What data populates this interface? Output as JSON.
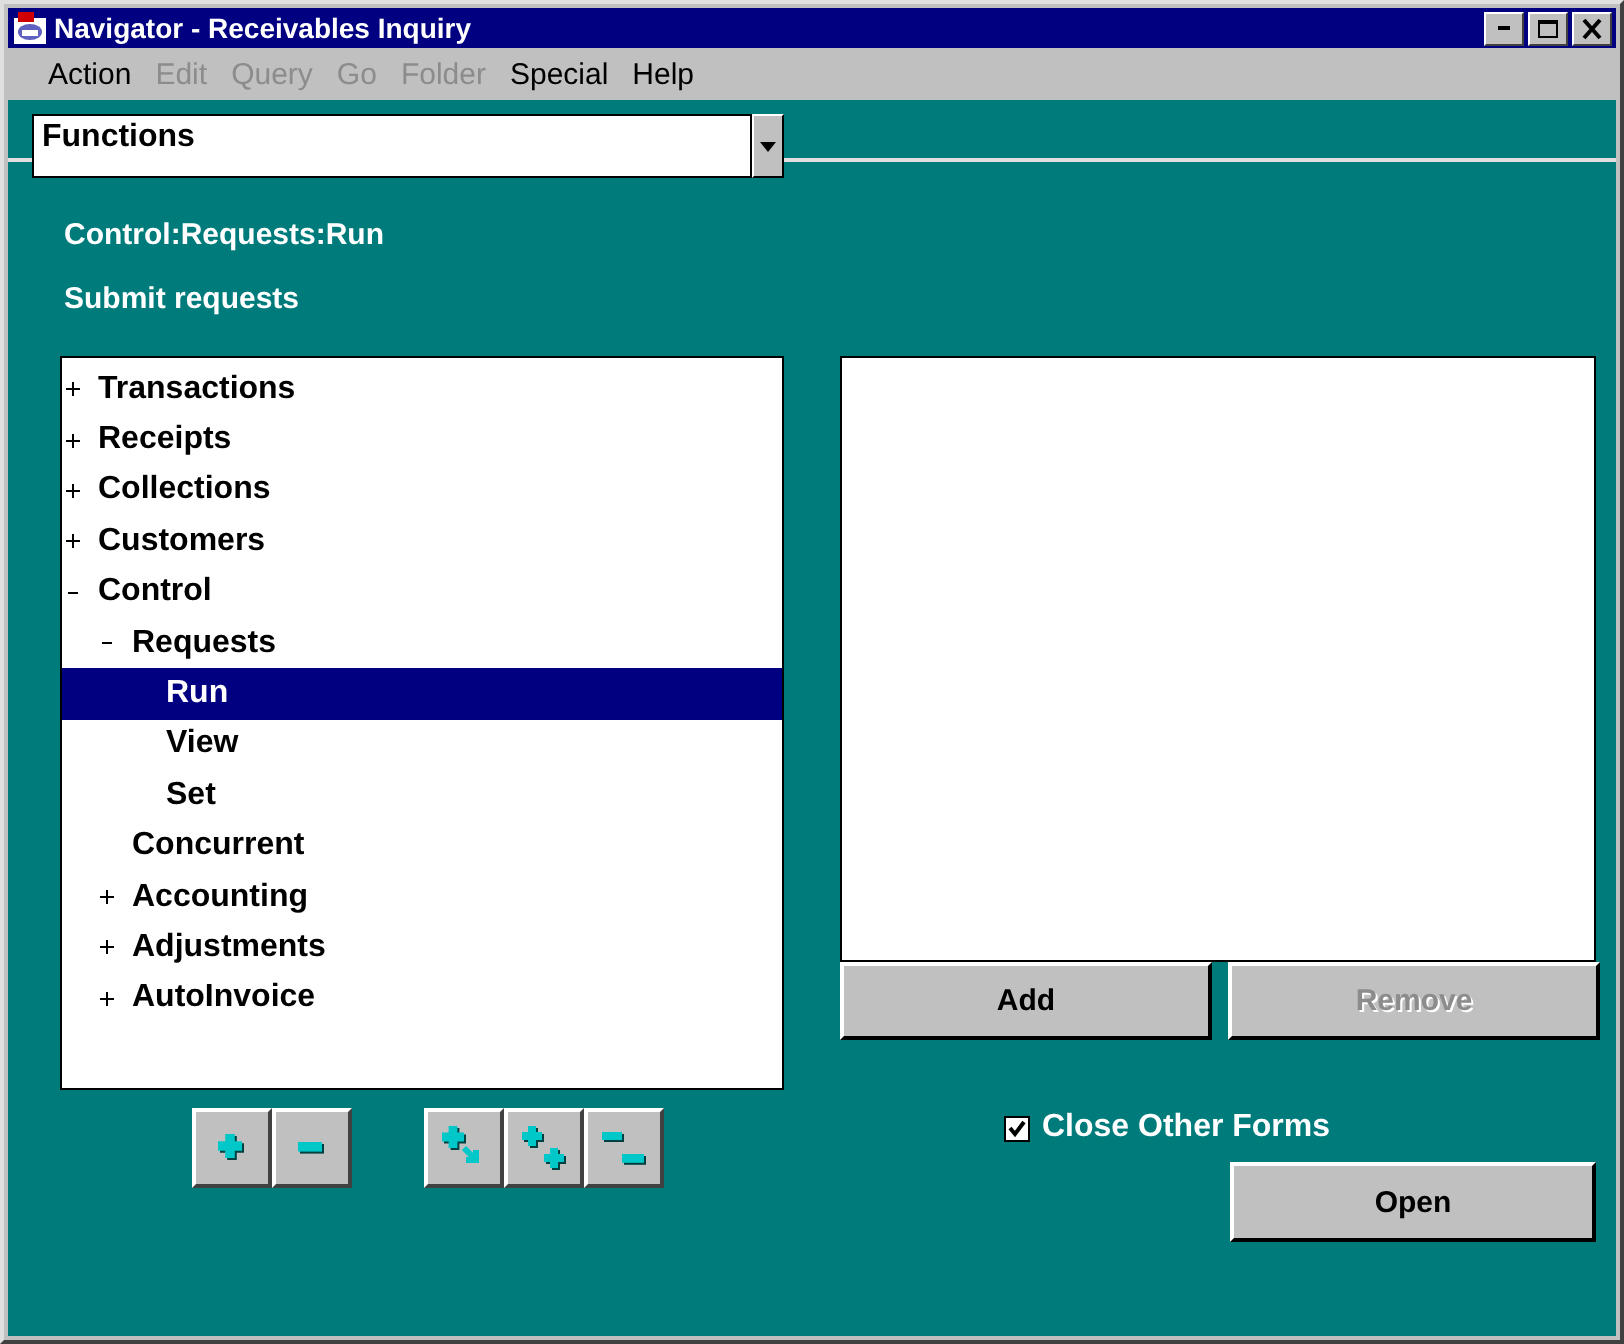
{
  "window": {
    "title": "Navigator - Receivables Inquiry"
  },
  "menu": [
    {
      "label": "Action",
      "disabled": false
    },
    {
      "label": "Edit",
      "disabled": true
    },
    {
      "label": "Query",
      "disabled": true
    },
    {
      "label": "Go",
      "disabled": true
    },
    {
      "label": "Folder",
      "disabled": true
    },
    {
      "label": "Special",
      "disabled": false
    },
    {
      "label": "Help",
      "disabled": false
    }
  ],
  "selector": {
    "value": "Functions"
  },
  "path": "Control:Requests:Run",
  "description": "Submit requests",
  "tree": [
    {
      "label": "Transactions",
      "expanded": false,
      "selected": false
    },
    {
      "label": "Receipts",
      "expanded": false,
      "selected": false
    },
    {
      "label": "Collections",
      "expanded": false,
      "selected": false
    },
    {
      "label": "Customers",
      "expanded": false,
      "selected": false
    },
    {
      "label": "Control",
      "expanded": true,
      "selected": false,
      "children": [
        {
          "label": "Requests",
          "expanded": true,
          "selected": false,
          "children": [
            {
              "label": "Run",
              "selected": true
            },
            {
              "label": "View",
              "selected": false
            },
            {
              "label": "Set",
              "selected": false
            }
          ]
        },
        {
          "label": "Concurrent",
          "selected": false
        },
        {
          "label": "Accounting",
          "expanded": false,
          "selected": false
        },
        {
          "label": "Adjustments",
          "expanded": false,
          "selected": false
        },
        {
          "label": "AutoInvoice",
          "expanded": false,
          "selected": false
        }
      ]
    }
  ],
  "tree_tools": [
    {
      "kind": "expand"
    },
    {
      "kind": "collapse"
    },
    {
      "kind": "expand-branch"
    },
    {
      "kind": "expand-all"
    },
    {
      "kind": "collapse-all"
    }
  ],
  "list_buttons": [
    {
      "label": "Add",
      "disabled": false
    },
    {
      "label": "Remove",
      "disabled": true
    }
  ],
  "close_other_forms": {
    "label": "Close Other Forms",
    "checked": true
  },
  "open_button": {
    "label": "Open"
  }
}
